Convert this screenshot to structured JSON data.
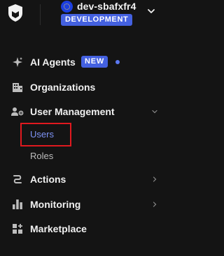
{
  "header": {
    "tenant_name": "dev-sbafxfr4",
    "environment_badge": "DEVELOPMENT"
  },
  "nav": {
    "ai_agents": {
      "label": "AI Agents",
      "badge": "NEW"
    },
    "organizations": {
      "label": "Organizations"
    },
    "user_management": {
      "label": "User Management",
      "children": [
        {
          "label": "Users",
          "active": true
        },
        {
          "label": "Roles",
          "active": false
        }
      ]
    },
    "actions": {
      "label": "Actions"
    },
    "monitoring": {
      "label": "Monitoring"
    },
    "marketplace": {
      "label": "Marketplace"
    }
  },
  "icons": {
    "logo": "auth0-shield-logo",
    "tenant": "globe-flag-icon",
    "ai_agents": "sparkle-icon",
    "organizations": "building-icon",
    "user_management": "users-gear-icon",
    "actions": "flow-icon",
    "monitoring": "bar-chart-icon",
    "marketplace": "grid-plus-icon"
  },
  "colors": {
    "background": "#141414",
    "accent": "#4461e0",
    "active_link": "#7f94f7",
    "highlight": "#e0191f"
  }
}
